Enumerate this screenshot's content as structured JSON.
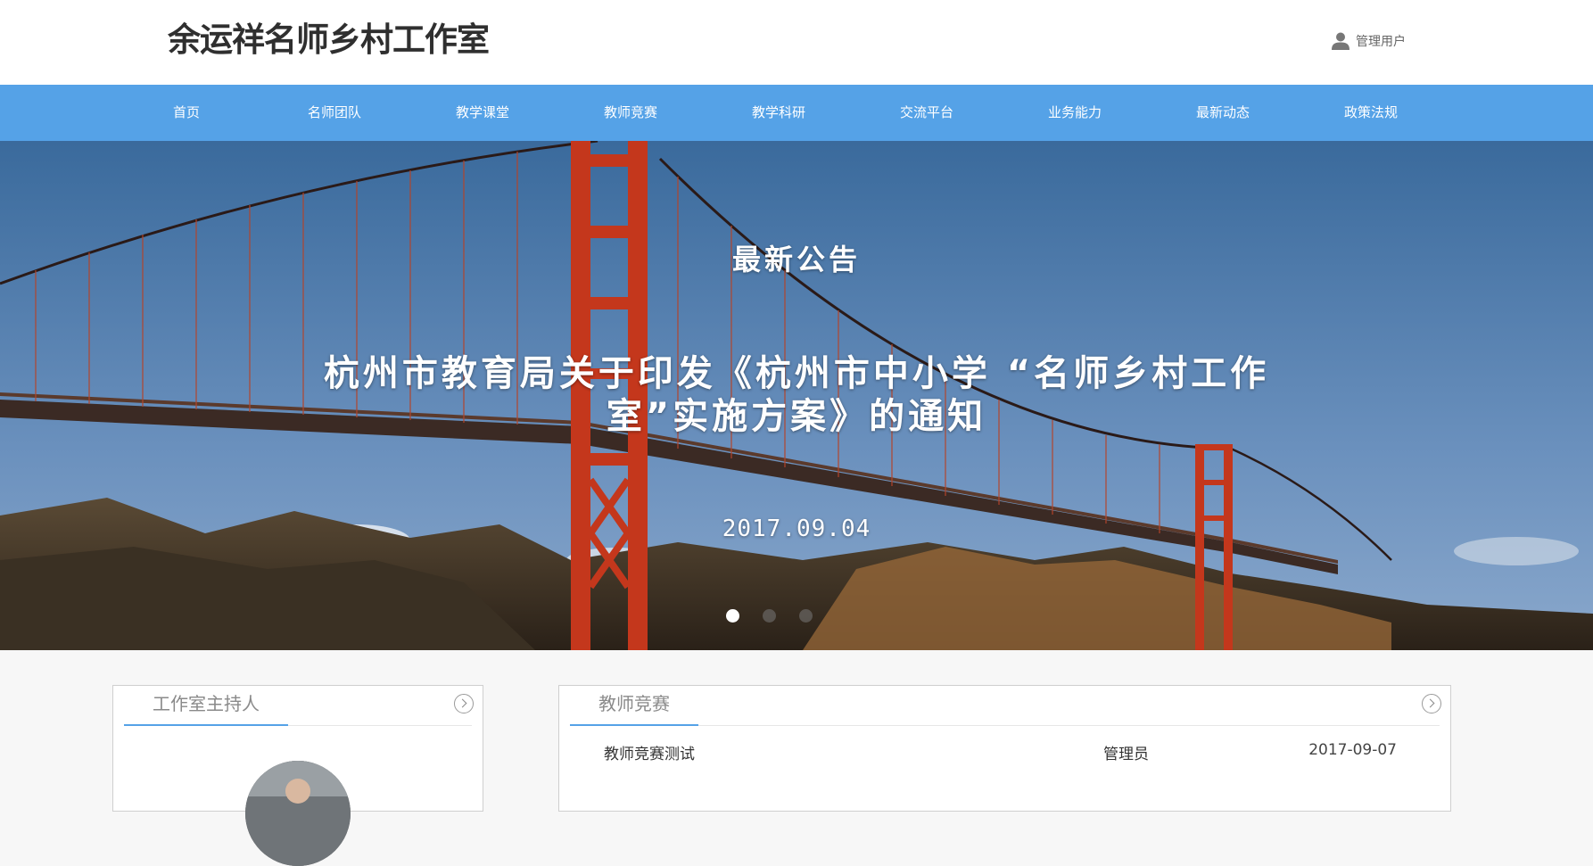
{
  "header": {
    "logo": "余运祥名师乡村工作室",
    "user_label": "管理用户",
    "user_icon": "user-icon"
  },
  "nav": {
    "items": [
      "首页",
      "名师团队",
      "教学课堂",
      "教师竞赛",
      "教学科研",
      "交流平台",
      "业务能力",
      "最新动态",
      "政策法规"
    ]
  },
  "hero": {
    "label": "最新公告",
    "title": "杭州市教育局关于印发《杭州市中小学 “名师乡村工作室”实施方案》的通知",
    "date": "2017.09.04",
    "slide_count": 3,
    "active_slide": 1
  },
  "panels": {
    "host": {
      "title": "工作室主持人",
      "more_icon": "chevron-right-circle-icon"
    },
    "competition": {
      "title": "教师竞赛",
      "more_icon": "chevron-right-circle-icon",
      "rows": [
        {
          "title": "教师竞赛测试",
          "author": "管理员",
          "date": "2017-09-07"
        }
      ]
    }
  },
  "colors": {
    "accent": "#55a2e7",
    "bridge": "#c4371c",
    "sky_top": "#3f6f9f",
    "sky_bottom": "#6e95c2"
  }
}
